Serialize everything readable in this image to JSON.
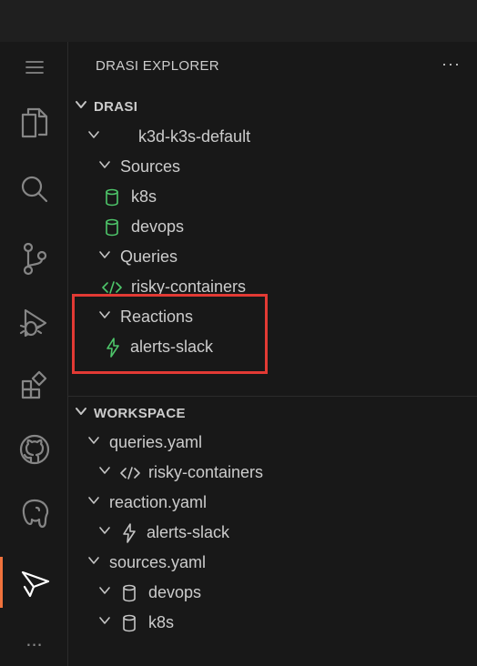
{
  "activity_bar": {
    "items": [
      {
        "name": "menu-icon"
      },
      {
        "name": "explorer-icon"
      },
      {
        "name": "search-icon"
      },
      {
        "name": "source-control-icon"
      },
      {
        "name": "run-debug-icon"
      },
      {
        "name": "extensions-icon"
      },
      {
        "name": "github-icon"
      },
      {
        "name": "postgres-icon"
      },
      {
        "name": "drasi-icon",
        "active": true
      },
      {
        "name": "more-icon",
        "label": "..."
      }
    ]
  },
  "sidebar": {
    "title": "DRASI EXPLORER",
    "more_label": "···",
    "drasi_section": {
      "label": "DRASI",
      "cluster": "k3d-k3s-default",
      "sources_label": "Sources",
      "sources": [
        "k8s",
        "devops"
      ],
      "queries_label": "Queries",
      "queries": [
        "risky-containers"
      ],
      "reactions_label": "Reactions",
      "reactions": [
        "alerts-slack"
      ]
    },
    "workspace_section": {
      "label": "WORKSPACE",
      "files": [
        {
          "file": "queries.yaml",
          "items": [
            "risky-containers"
          ]
        },
        {
          "file": "reaction.yaml",
          "items": [
            "alerts-slack"
          ]
        },
        {
          "file": "sources.yaml",
          "items": [
            "devops",
            "k8s"
          ]
        }
      ]
    }
  },
  "colors": {
    "accent": "#f0723c",
    "icon_green": "#4ec66a",
    "highlight": "#e23a34"
  }
}
